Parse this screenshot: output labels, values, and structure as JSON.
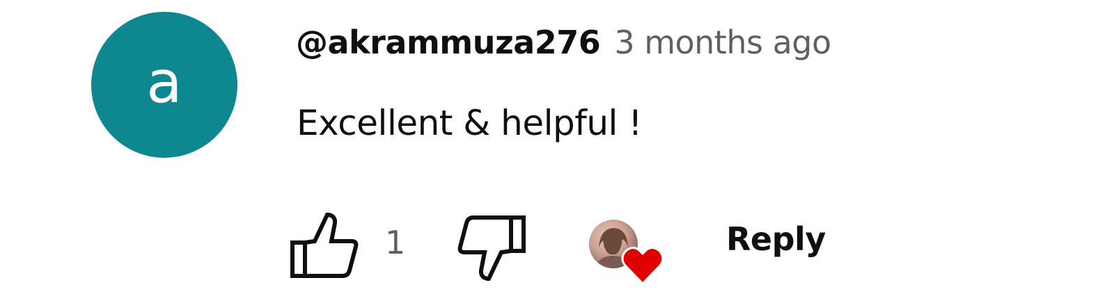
{
  "comment": {
    "avatar_letter": "a",
    "avatar_color": "#0e8790",
    "author": "@akrammuza276",
    "published": "3 months ago",
    "text": "Excellent & helpful !",
    "actions": {
      "like_icon": "thumbs-up-icon",
      "like_count": "1",
      "dislike_icon": "thumbs-down-icon",
      "creator_heart_icon": "heart-icon",
      "heart_color": "#e00000",
      "reply_label": "Reply"
    }
  }
}
